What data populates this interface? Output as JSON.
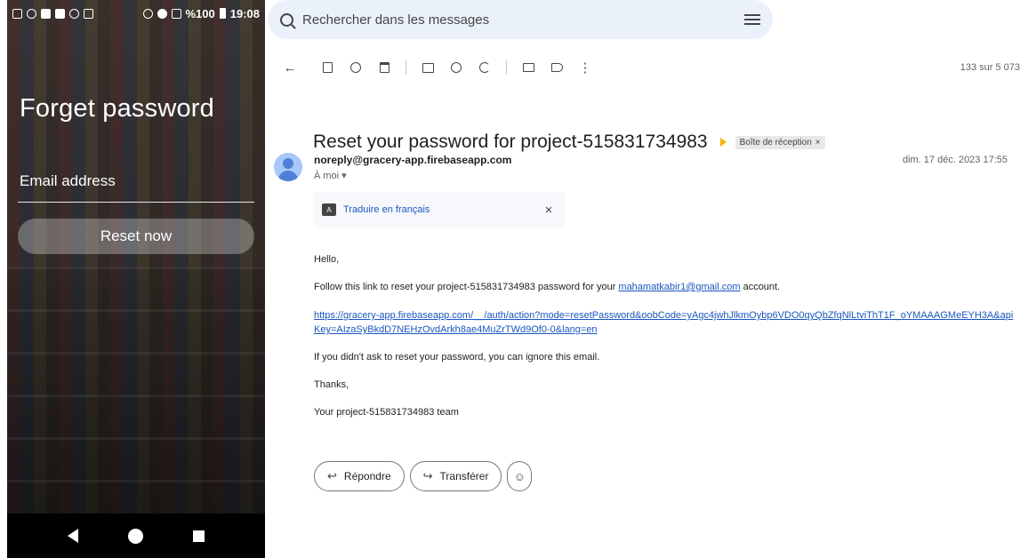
{
  "phone": {
    "status_battery": "%100",
    "status_time": "19:08",
    "title": "Forget password",
    "email_label": "Email address",
    "reset_button": "Reset now"
  },
  "gmail": {
    "search_placeholder": "Rechercher dans les messages",
    "pager": "133 sur 5 073",
    "subject": "Reset your password for project-515831734983",
    "label_chip": "Boîte de réception",
    "label_chip_close": "×",
    "sender": "noreply@gracery-app.firebaseapp.com",
    "recipient": "À moi ▾",
    "date": "dim. 17 déc. 2023 17:55",
    "translate": "Traduire en français",
    "translate_close": "×",
    "body": {
      "hello": "Hello,",
      "follow_prefix": "Follow this link to reset your project-515831734983 password for your ",
      "follow_email": "mahamatkabir1@gmail.com",
      "follow_suffix": " account.",
      "url": "https://gracery-app.firebaseapp.com/__/auth/action?mode=resetPassword&oobCode=yAgc4jwhJlkmOybp6VDO0qyQbZfqNlLtviThT1F_oYMAAAGMeEYH3A&apiKey=AIzaSyBkdD7NEHzOvdArkh8ae4MuZrTWd9Of0-0&lang=en",
      "ignore": "If you didn't ask to reset your password, you can ignore this email.",
      "thanks": "Thanks,",
      "team": "Your project-515831734983 team"
    },
    "reply_button": "Répondre",
    "forward_button": "Transférer",
    "colors": {
      "search_bg": "#eaf1fb",
      "link": "#1a56c0",
      "importance": "#f4b400"
    }
  }
}
